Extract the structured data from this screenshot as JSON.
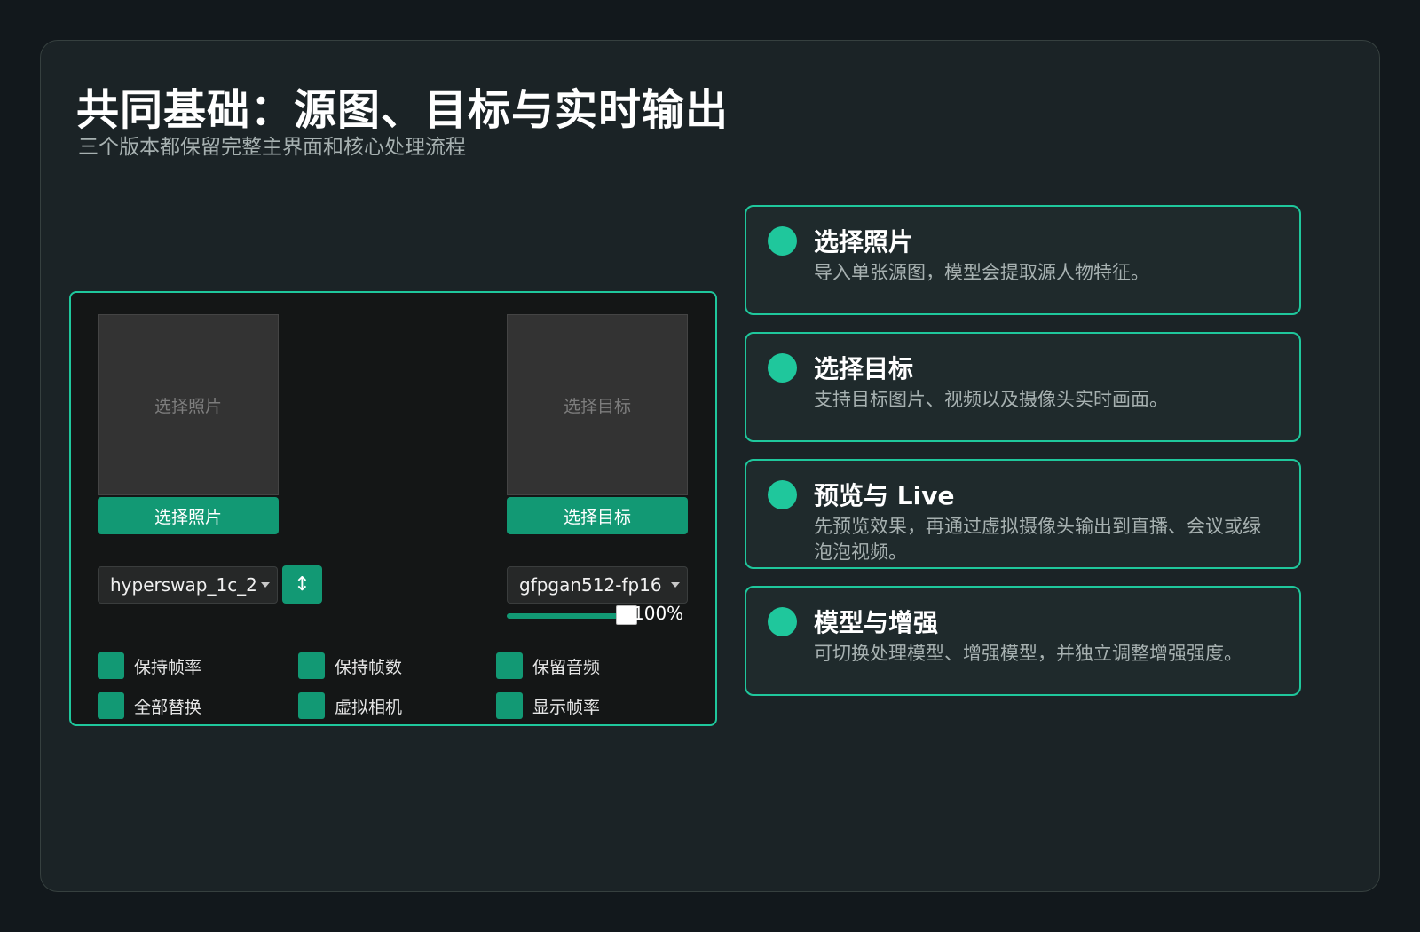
{
  "header": {
    "title": "共同基础：源图、目标与实时输出",
    "subtitle": "三个版本都保留完整主界面和核心处理流程"
  },
  "app": {
    "source_preview_placeholder": "选择照片",
    "target_preview_placeholder": "选择目标",
    "select_source_button": "选择照片",
    "select_target_button": "选择目标",
    "model_select_value": "hyperswap_1c_2",
    "swap_button_icon": "↕",
    "enhancer_select_value": "gfpgan512-fp16",
    "enhancer_strength": "100%",
    "enhancer_strength_fraction": 1.0,
    "checkboxes": [
      {
        "label": "保持帧率",
        "checked": true
      },
      {
        "label": "保持帧数",
        "checked": true
      },
      {
        "label": "保留音频",
        "checked": true
      },
      {
        "label": "全部替换",
        "checked": true
      },
      {
        "label": "虚拟相机",
        "checked": true
      },
      {
        "label": "显示帧率",
        "checked": true
      }
    ]
  },
  "features": [
    {
      "title": "选择照片",
      "desc": "导入单张源图，模型会提取源人物特征。"
    },
    {
      "title": "选择目标",
      "desc": "支持目标图片、视频以及摄像头实时画面。"
    },
    {
      "title": "预览与 Live",
      "desc": "先预览效果，再通过虚拟摄像头输出到直播、会议或绿泡泡视频。"
    },
    {
      "title": "模型与增强",
      "desc": "可切换处理模型、增强模型，并独立调整增强强度。"
    }
  ],
  "colors": {
    "accent": "#1fc79c",
    "button": "#129974",
    "background": "#12181c",
    "panel": "#1b2326"
  }
}
